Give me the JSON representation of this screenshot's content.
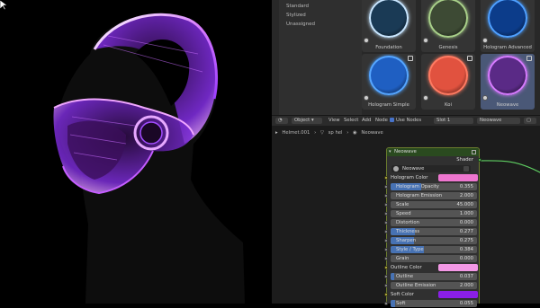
{
  "viewport": {
    "cursor": "arrow-cursor"
  },
  "material_browser": {
    "categories": [
      "Standard",
      "Stylized",
      "Unassigned"
    ],
    "tiles": [
      {
        "label": "Foundation",
        "color": "#1a3a55",
        "glow": "#c9e6ff"
      },
      {
        "label": "Genesis",
        "color": "#3d4a34",
        "glow": "#a9d08a"
      },
      {
        "label": "Hologram Advanced",
        "color": "#0c3c8a",
        "glow": "#4fa0ff"
      },
      {
        "label": "Hologram Simple",
        "color": "#1f5fc2",
        "glow": "#56a6ff"
      },
      {
        "label": "Koi",
        "color": "#e1523f",
        "glow": "#ff7b62"
      },
      {
        "label": "Neowave",
        "color": "#5a2a86",
        "glow": "#d77cff"
      }
    ]
  },
  "header": {
    "object_mode": "Object",
    "menus": [
      "View",
      "Select",
      "Add",
      "Node"
    ],
    "use_nodes_label": "Use Nodes",
    "slot": "Slot 1",
    "material": "Neowave"
  },
  "breadcrumb": {
    "object": "Helmet.001",
    "mesh": "sp hel",
    "material": "Neowave"
  },
  "node": {
    "title": "Neowave",
    "output": "Shader",
    "group": "Neowave",
    "props": [
      {
        "label": "Hologram Color",
        "kind": "color",
        "color": "#ee76cf"
      },
      {
        "label": "Hologram Opacity",
        "kind": "value",
        "value": "0.355",
        "fill": 0.355
      },
      {
        "label": "Hologram Emission",
        "kind": "value",
        "value": "2.000",
        "fill": 0
      },
      {
        "label": "Scale",
        "kind": "value",
        "value": "45.000",
        "fill": 0
      },
      {
        "label": "Speed",
        "kind": "value",
        "value": "1.000",
        "fill": 0
      },
      {
        "label": "Distortion",
        "kind": "value",
        "value": "0.000",
        "fill": 0
      },
      {
        "label": "Thickness",
        "kind": "value",
        "value": "0.277",
        "fill": 0.277
      },
      {
        "label": "Sharpen",
        "kind": "value",
        "value": "0.275",
        "fill": 0.275
      },
      {
        "label": "Style / Type",
        "kind": "value",
        "value": "0.384",
        "fill": 0.384
      },
      {
        "label": "Grain",
        "kind": "value",
        "value": "0.000",
        "fill": 0
      },
      {
        "label": "Outline Color",
        "kind": "color",
        "color": "#f398e5"
      },
      {
        "label": "Outline",
        "kind": "value",
        "value": "0.037",
        "fill": 0.037
      },
      {
        "label": "Outline Emission",
        "kind": "value",
        "value": "2.000",
        "fill": 0
      },
      {
        "label": "Soft Color",
        "kind": "color",
        "color": "#8a1fe6"
      },
      {
        "label": "Soft",
        "kind": "value",
        "value": "0.055",
        "fill": 0.055
      }
    ]
  }
}
